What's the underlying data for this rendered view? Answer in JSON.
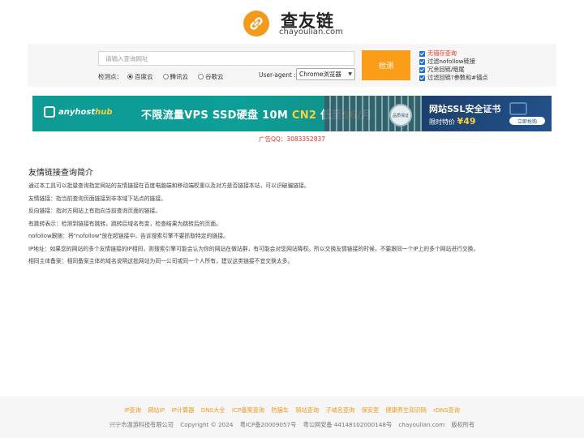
{
  "logo": {
    "title": "查友链",
    "domain": "chayoulian.com",
    "icon": "link-icon",
    "color": "#f39a1d"
  },
  "search": {
    "placeholder": "请输入查询网址",
    "detect_label": "检测点：",
    "engines": [
      {
        "label": "百度云",
        "selected": true
      },
      {
        "label": "腾讯云",
        "selected": false
      },
      {
        "label": "谷歌云",
        "selected": false
      }
    ],
    "ua_label": "User-agent :",
    "ua_value": "Chrome浏览器",
    "button": "检测",
    "button_color": "#fa9d18",
    "options": [
      {
        "label": "无锚存查询",
        "checked": true,
        "color": "#e23c2a"
      },
      {
        "label": "过滤nofollow链接",
        "checked": true
      },
      {
        "label": "冗余回链/暗尾",
        "checked": true
      },
      {
        "label": "过滤回链?参数和#锚点",
        "checked": true
      }
    ]
  },
  "banner": {
    "brand_a": "anyhost",
    "brand_b": "hub",
    "headline_a": "不限流量VPS SSD硬盘 10M ",
    "headline_b": "CN2",
    "headline_c": " 低至",
    "headline_price": "$6",
    "headline_d": "/月",
    "stamp": "品质保证",
    "ssl_title": "网站SSL安全证书",
    "ssl_price_label": "限时特价 ",
    "ssl_price": "¥49",
    "ssl_button": "立即抢购"
  },
  "ad_qq": "广告QQ：3083352837",
  "intro": {
    "title": "友情链接查询简介",
    "paragraphs": [
      "通过本工具可以批量查询指定网站的友情链接在百度电脑端和移动端权重以及对方是否链接本站，可以识破骗链接。",
      "友情链接：指当前查询页面链接到非本域下站点的链接。",
      "反向链接：指对方网站上有指向当前查询页面的链接。",
      "有跳转表示：检测到链接有跳转，跳转后域名有变，检查结果为跳转后的页面。",
      "nofollow跟随：将\"nofollow\"放在超链接中，告诉搜索引擎不要抓取特定的链接。",
      "IP地址：如果您的网站的多个友情链接的IP相同，则搜索引擎可能会认为你的网站在做站群，有可能会对您网站降权。所以交换友情链接的时候，不要跟同一个IP上的多个网站进行交换。",
      "相同主体备案：相同备案主体的域名说明这批网站为同一公司或同一个人所有，建议这类链接不宜交换太多。"
    ]
  },
  "footer": {
    "links": [
      "IP查询",
      "网站IP",
      "IP计算器",
      "DNS大全",
      "ICP备案查询",
      "防骗车",
      "骑站查询",
      "子域名查询",
      "保安室",
      "健康养生知识网",
      "rDNS查询"
    ],
    "copy": [
      "兴宁市温游科技有限公司",
      "Copyright © 2024",
      "粤ICP备20009057号",
      "粤公网安备 44148102000148号",
      "chayoulian.com",
      "版权所有"
    ]
  }
}
